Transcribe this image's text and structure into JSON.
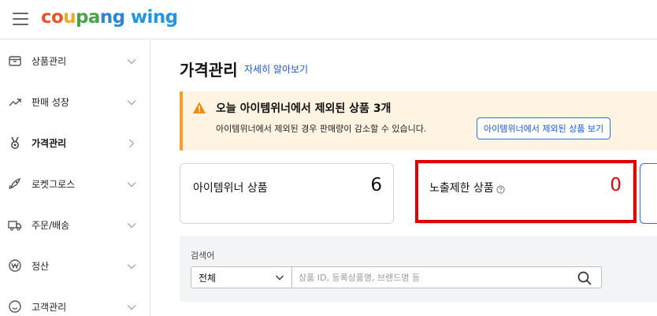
{
  "header": {
    "logo_parts": [
      "co",
      "u",
      "pa",
      "ng",
      " ",
      "wing"
    ],
    "logo_colors": [
      "#e8552b",
      "#f6a623",
      "#4aa34a",
      "#2d84d6",
      "#2d84d6",
      "#1f98e0"
    ]
  },
  "sidebar": {
    "items": [
      {
        "label": "상품관리",
        "icon": "box-icon"
      },
      {
        "label": "판매 성장",
        "icon": "trend-icon"
      },
      {
        "label": "가격관리",
        "icon": "medal-icon"
      },
      {
        "label": "로켓그로스",
        "icon": "rocket-icon"
      },
      {
        "label": "주문/배송",
        "icon": "truck-icon"
      },
      {
        "label": "정산",
        "icon": "won-icon"
      },
      {
        "label": "고객관리",
        "icon": "smile-icon"
      }
    ]
  },
  "main": {
    "title": "가격관리",
    "learn_more": "자세히 알아보기",
    "alert": {
      "title": "오늘 아이템위너에서 제외된 상품 3개",
      "description": "아이템위너에서 제외된 경우 판매량이 감소할 수 있습니다.",
      "button": "아이템위너에서 제외된 상품 보기",
      "accent": "#f59d2a"
    },
    "cards": [
      {
        "label": "아이템위너 상품",
        "value": "6"
      },
      {
        "label": "노출제한 상품",
        "value": "0"
      }
    ],
    "search": {
      "label": "검색어",
      "select_value": "전체",
      "placeholder": "상품 ID, 등록상품명, 브랜드명 등"
    }
  }
}
